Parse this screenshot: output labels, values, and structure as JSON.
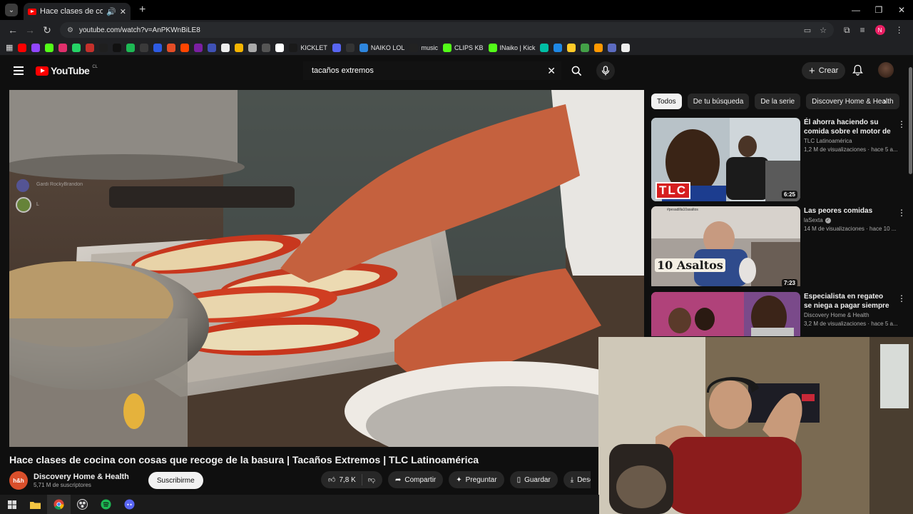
{
  "browser": {
    "tab_title": "Hace clases de cocina con cosas que recoge de la basura",
    "url": "youtube.com/watch?v=AnPKWnBiLE8",
    "profile_initial": "N"
  },
  "bookmarks": [
    {
      "label": "",
      "color": "#ff0000"
    },
    {
      "label": "",
      "color": "#9146ff"
    },
    {
      "label": "",
      "color": "#53fc18"
    },
    {
      "label": "",
      "color": "#e1306c"
    },
    {
      "label": "",
      "color": "#25d366"
    },
    {
      "label": "",
      "color": "#c4302b"
    },
    {
      "label": "",
      "color": "#1f1f1f"
    },
    {
      "label": "",
      "color": "#111111"
    },
    {
      "label": "",
      "color": "#1db954"
    },
    {
      "label": "",
      "color": "#3a3a3a"
    },
    {
      "label": "",
      "color": "#2d5be3"
    },
    {
      "label": "",
      "color": "#e44d26"
    },
    {
      "label": "",
      "color": "#ff4500"
    },
    {
      "label": "",
      "color": "#7b1fa2"
    },
    {
      "label": "",
      "color": "#3f51b5"
    },
    {
      "label": "",
      "color": "#eeeeee"
    },
    {
      "label": "",
      "color": "#f4b400"
    },
    {
      "label": "",
      "color": "#aaaaaa"
    },
    {
      "label": "",
      "color": "#555555"
    },
    {
      "label": "",
      "color": "#ffffff"
    },
    {
      "label": "KICKLET",
      "color": "#1a1a1a"
    },
    {
      "label": "",
      "color": "#5865f2"
    },
    {
      "label": "",
      "color": "#333333"
    },
    {
      "label": "NAIKO LOL",
      "color": "#2e86de"
    },
    {
      "label": "music",
      "color": "#222222"
    },
    {
      "label": "CLIPS KB",
      "color": "#53fc18"
    },
    {
      "label": "INaiko | Kick",
      "color": "#53fc18"
    },
    {
      "label": "",
      "color": "#00bfa5"
    },
    {
      "label": "",
      "color": "#1e88e5"
    },
    {
      "label": "",
      "color": "#ffca28"
    },
    {
      "label": "",
      "color": "#43a047"
    },
    {
      "label": "",
      "color": "#ff9800"
    },
    {
      "label": "",
      "color": "#5c6bc0"
    },
    {
      "label": "",
      "color": "#eeeeee"
    }
  ],
  "masthead": {
    "logo_text": "YouTube",
    "country_code": "CL",
    "search_value": "tacaños extremos",
    "create_label": "Crear"
  },
  "overlay": {
    "discord_user": "Gardi RockyBrandon",
    "discord_user2": "L"
  },
  "chips": [
    "Todos",
    "De tu búsqueda",
    "De la serie",
    "Discovery Home & Health"
  ],
  "recommendations": [
    {
      "title": "Él ahorra haciendo su comida sobre el motor de ...",
      "channel": "TLC Latinoamérica",
      "meta": "1,2 M de visualizaciones · hace 5 a...",
      "duration": "6:25",
      "thumb_text": "TLC",
      "verified": false
    },
    {
      "title": "Las peores comidas",
      "channel": "laSexta",
      "meta": "14 M de visualizaciones · hace 10 ...",
      "duration": "7:23",
      "thumb_text": "10 Asaltos",
      "thumb_caption": "#pesadilla10asaltos",
      "verified": true
    },
    {
      "title": "Especialista en regateo se niega a pagar siempre el ...",
      "channel": "Discovery Home & Health",
      "meta": "3,2 M de visualizaciones · hace 5 a...",
      "duration": "",
      "verified": false
    }
  ],
  "video": {
    "title": "Hace clases de cocina con cosas que recoge de la basura | Tacaños Extremos | TLC Latinoamérica",
    "channel": "Discovery Home & Health",
    "channel_avatar": "h&h",
    "subscribers": "5,71 M de suscriptores",
    "subscribe_label": "Suscribirme",
    "likes": "7,8 K",
    "share_label": "Compartir",
    "ask_label": "Preguntar",
    "save_label": "Guardar",
    "download_label": "Desc"
  },
  "colors": {
    "accent": "#ff0000",
    "background": "#0f0f0f",
    "chip_bg": "#272727"
  }
}
